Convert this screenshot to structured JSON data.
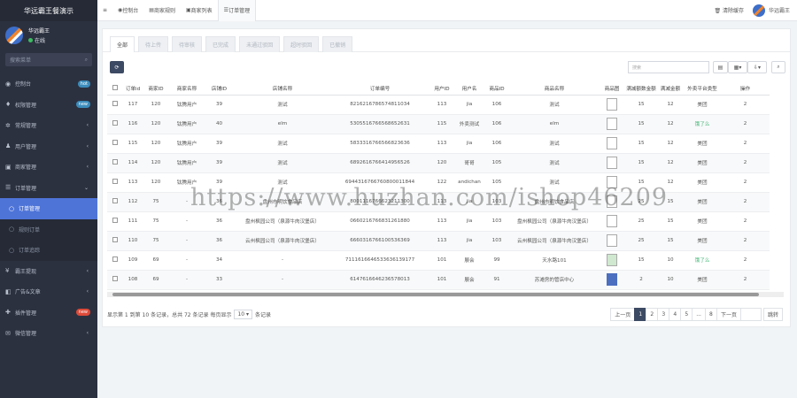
{
  "brand": "华远霸王餐演示",
  "user": {
    "name": "华远霸王",
    "status": "在线"
  },
  "sidebar_search_placeholder": "搜索菜单",
  "menu": [
    {
      "label": "控制台",
      "badge": "hot",
      "badge_color": "#3c8dbc",
      "icon": "dashboard-icon"
    },
    {
      "label": "权限管理",
      "badge": "new",
      "badge_color": "#3c8dbc",
      "icon": "lock-icon"
    },
    {
      "label": "常规管理",
      "arrow": "‹",
      "icon": "gear-icon"
    },
    {
      "label": "用户管理",
      "arrow": "‹",
      "icon": "user-icon"
    },
    {
      "label": "商家管理",
      "arrow": "‹",
      "icon": "shop-icon"
    },
    {
      "label": "订单管理",
      "arrow": "⌄",
      "icon": "list-icon"
    },
    {
      "label": "订单管理",
      "active": true,
      "sub": true
    },
    {
      "label": "规则订单",
      "sub": true
    },
    {
      "label": "订单追踪",
      "sub": true
    },
    {
      "label": "霸王提现",
      "arrow": "‹",
      "icon": "money-icon"
    },
    {
      "label": "广告&文章",
      "arrow": "‹",
      "icon": "ad-icon"
    },
    {
      "label": "插件管理",
      "badge": "new",
      "badge_color": "#dd4b39",
      "icon": "plugin-icon"
    },
    {
      "label": "微信管理",
      "arrow": "‹",
      "icon": "wechat-icon"
    }
  ],
  "topbar": {
    "tabs": [
      {
        "label": "控制台",
        "icon": "dashboard-icon"
      },
      {
        "label": "商家规则",
        "icon": "rule-icon"
      },
      {
        "label": "商家列表",
        "icon": "shop-icon"
      },
      {
        "label": "订单管理",
        "icon": "list-icon",
        "selected": true
      }
    ],
    "clear_cache": "清除缓存",
    "site": "华远霸王"
  },
  "status_tabs": [
    "全部",
    "待上传",
    "待审核",
    "已完成",
    "未通过驳回",
    "超时驳回",
    "已撤销"
  ],
  "search_placeholder": "搜索",
  "columns": [
    "",
    "订单id",
    "商家ID",
    "商家名称",
    "店铺ID",
    "店铺名称",
    "订单编号",
    "用户ID",
    "用户名",
    "商品ID",
    "商品名称",
    "商品图",
    "满减额数金额",
    "满减金额",
    "外卖平台类型",
    "操作"
  ],
  "rows": [
    [
      "117",
      "120",
      "钛腾用户",
      "39",
      "测试",
      "8216216786574811034",
      "113",
      "jia",
      "106",
      "测试",
      "img",
      "15",
      "12",
      "美团",
      "2"
    ],
    [
      "116",
      "120",
      "钛腾用户",
      "40",
      "elm",
      "5305516766568652631",
      "115",
      "外卖测试",
      "106",
      "elm",
      "img",
      "15",
      "12",
      "饿了么",
      "2"
    ],
    [
      "115",
      "120",
      "钛腾用户",
      "39",
      "测试",
      "5833316766566823636",
      "113",
      "jia",
      "106",
      "测试",
      "img",
      "15",
      "12",
      "美团",
      "2"
    ],
    [
      "114",
      "120",
      "钛腾用户",
      "39",
      "测试",
      "6892616766414956526",
      "120",
      "哥哥",
      "105",
      "测试",
      "img",
      "15",
      "12",
      "美团",
      "2"
    ],
    [
      "113",
      "120",
      "钛腾用户",
      "39",
      "测试",
      "6944316766760800011844",
      "122",
      "andichan",
      "105",
      "测试",
      "img",
      "15",
      "12",
      "美团",
      "2"
    ],
    [
      "112",
      "75",
      "-",
      "36",
      "盘州市明饮食品店",
      "8001116766623211300",
      "113",
      "jia",
      "103",
      "盘州市明饮食品店",
      "img",
      "25",
      "15",
      "美团",
      "2"
    ],
    [
      "111",
      "75",
      "-",
      "36",
      "盘州枫园公司（泉源牛肉汉堡店）",
      "0660216766831261880",
      "113",
      "jia",
      "103",
      "盘州枫园公司（泉源牛肉汉堡店）",
      "img",
      "25",
      "15",
      "美团",
      "2"
    ],
    [
      "110",
      "75",
      "-",
      "36",
      "云州枫园公司（泉源牛肉汉堡店）",
      "6660316766100536369",
      "113",
      "jia",
      "103",
      "云州枫园公司（泉源牛肉汉堡店）",
      "img",
      "25",
      "15",
      "美团",
      "2"
    ],
    [
      "109",
      "69",
      "-",
      "34",
      "-",
      "7111616646533636139177",
      "101",
      "展会",
      "99",
      "天水路101",
      "img-green",
      "15",
      "10",
      "饿了么",
      "2"
    ],
    [
      "108",
      "69",
      "-",
      "33",
      "-",
      "6147616646236578013",
      "101",
      "展会",
      "91",
      "苏滩房的管店中心",
      "img-blue",
      "2",
      "10",
      "美团",
      "2"
    ]
  ],
  "footer": {
    "summary": "显示第 1 到第 10 条记录，总共 72 条记录 每页显示",
    "page_size": "10",
    "suffix": "条记录"
  },
  "pager": [
    "上一页",
    "1",
    "2",
    "3",
    "4",
    "5",
    "...",
    "8",
    "下一页"
  ],
  "pager_go": "跳转",
  "watermark": "https://www.huzhan.com/ishop46209"
}
